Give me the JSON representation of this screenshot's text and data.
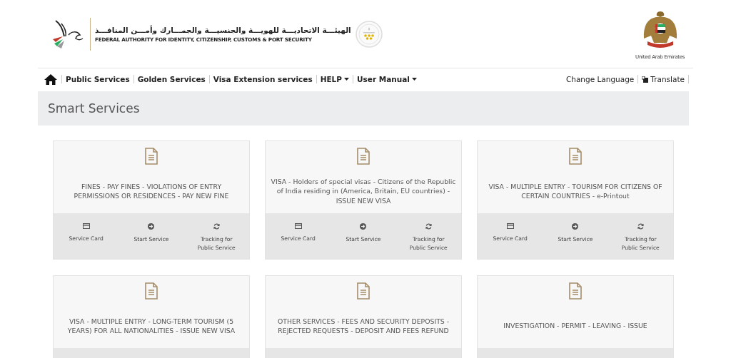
{
  "header": {
    "title_arabic": "الهيئـــة الاتحاديـــة للهويـــة والجنسيـــة والجمـــارك وأمـــن المنافـــذ",
    "title_english": "FEDERAL AUTHORITY FOR IDENTITY, CITIZENSHIP, CUSTOMS & PORT SECURITY",
    "emblem_caption": "United Arab Emirates"
  },
  "nav": {
    "items": [
      {
        "label": "Public Services",
        "dropdown": false
      },
      {
        "label": "Golden Services",
        "dropdown": false
      },
      {
        "label": "Visa Extension services",
        "dropdown": false
      },
      {
        "label": "HELP",
        "dropdown": true
      },
      {
        "label": "User Manual",
        "dropdown": true
      }
    ],
    "right": [
      {
        "label": "Change Language",
        "kind": "link"
      },
      {
        "label": "Translate",
        "kind": "translate"
      }
    ]
  },
  "page_title": "Smart Services",
  "cards": [
    {
      "title": "FINES - PAY FINES - VIOLATIONS OF ENTRY PERMISSIONS OR RESIDENCES - PAY NEW FINE",
      "actions": [
        {
          "label": "Service Card",
          "kind": "card"
        },
        {
          "label": "Start Service",
          "kind": "start"
        },
        {
          "label": "Tracking for Public Service",
          "kind": "tracking"
        }
      ]
    },
    {
      "title": "VISA - Holders of special visas - Citizens of the Republic of India residing in (America, Britain, EU countries) - ISSUE NEW VISA",
      "actions": [
        {
          "label": "Service Card",
          "kind": "card"
        },
        {
          "label": "Start Service",
          "kind": "start"
        },
        {
          "label": "Tracking for Public Service",
          "kind": "tracking"
        }
      ]
    },
    {
      "title": "VISA - MULTIPLE ENTRY - TOURISM FOR CITIZENS OF CERTAIN COUNTRIES - e-Printout",
      "actions": [
        {
          "label": "Service Card",
          "kind": "card"
        },
        {
          "label": "Start Service",
          "kind": "start"
        },
        {
          "label": "Tracking for Public Service",
          "kind": "tracking"
        }
      ]
    },
    {
      "title": "VISA - MULTIPLE ENTRY - LONG-TERM TOURISM (5 YEARS) FOR ALL NATIONALITIES - ISSUE NEW VISA"
    },
    {
      "title": "OTHER SERVICES - FEES AND SECURITY DEPOSITS - REJECTED REQUESTS - DEPOSIT AND FEES REFUND"
    },
    {
      "title": "INVESTIGATION - PERMIT - LEAVING - ISSUE"
    }
  ]
}
